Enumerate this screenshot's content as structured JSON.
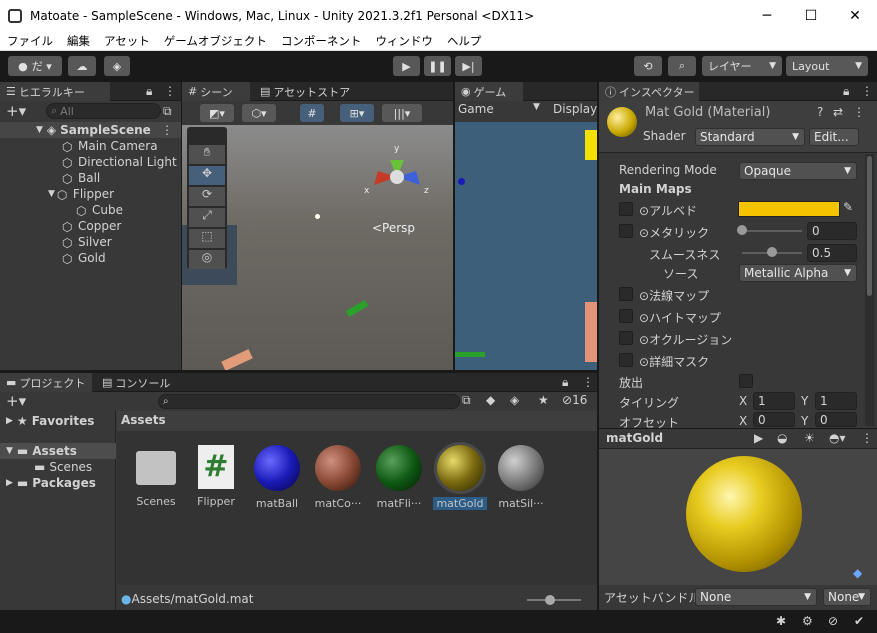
{
  "window": {
    "title": "Matoate - SampleScene - Windows, Mac, Linux - Unity 2021.3.2f1 Personal <DX11>",
    "min": "─",
    "max": "☐",
    "close": "✕"
  },
  "menu": [
    "ファイル",
    "編集",
    "アセット",
    "ゲームオブジェクト",
    "コンポーネント",
    "ウィンドウ",
    "ヘルプ"
  ],
  "toolbar": {
    "account": "だ ▾",
    "layers": "レイヤー",
    "layout": "Layout"
  },
  "hierarchy": {
    "tab": "ヒエラルキー",
    "search_placeholder": "All",
    "scene": "SampleScene",
    "items": [
      "Main Camera",
      "Directional Light",
      "Ball",
      "Flipper",
      "Cube",
      "Copper",
      "Silver",
      "Gold"
    ]
  },
  "scene": {
    "tab": "シーン",
    "tab2": "アセットストア",
    "persp": "<Persp",
    "axis_y": "y",
    "axis_x": "x",
    "axis_z": "z"
  },
  "game": {
    "tab": "ゲーム",
    "display_sel": "Game",
    "display": "Display"
  },
  "inspector": {
    "tab": "インスペクター",
    "title": "Mat Gold (Material)",
    "shader_label": "Shader",
    "shader": "Standard",
    "edit": "Edit...",
    "rendering_mode_label": "Rendering Mode",
    "rendering_mode": "Opaque",
    "main_maps": "Main Maps",
    "albedo": "アルベド",
    "metallic": "メタリック",
    "metallic_val": "0",
    "smoothness": "スムースネス",
    "smoothness_val": "0.5",
    "source": "ソース",
    "source_val": "Metallic Alpha",
    "normal": "法線マップ",
    "height": "ハイトマップ",
    "occlusion": "オクルージョン",
    "detail": "詳細マスク",
    "emission": "放出",
    "tiling": "タイリング",
    "tile_x": "1",
    "tile_y": "1",
    "offset": "オフセット",
    "off_x": "0",
    "off_y": "0",
    "X": "X",
    "Y": "Y",
    "preview_name": "matGold",
    "asset_bundle": "アセットバンドル",
    "bundle": "None",
    "bundle2": "None",
    "albedo_color": "#f5c400"
  },
  "project": {
    "tab": "プロジェクト",
    "tab2": "コンソール",
    "favorites": "Favorites",
    "assets": "Assets",
    "scenes": "Scenes",
    "packages": "Packages",
    "header": "Assets",
    "count": "16",
    "path": "Assets/matGold.mat",
    "items": [
      {
        "name": "Scenes",
        "kind": "folder"
      },
      {
        "name": "Flipper",
        "kind": "script"
      },
      {
        "name": "matBall",
        "color": "#1a1ab8"
      },
      {
        "name": "matCo···",
        "color": "#8a4a35"
      },
      {
        "name": "matFli···",
        "color": "#0f5a14"
      },
      {
        "name": "matGold",
        "color": "#7a6a10"
      },
      {
        "name": "matSil···",
        "color": "#7d7d7d"
      }
    ]
  }
}
